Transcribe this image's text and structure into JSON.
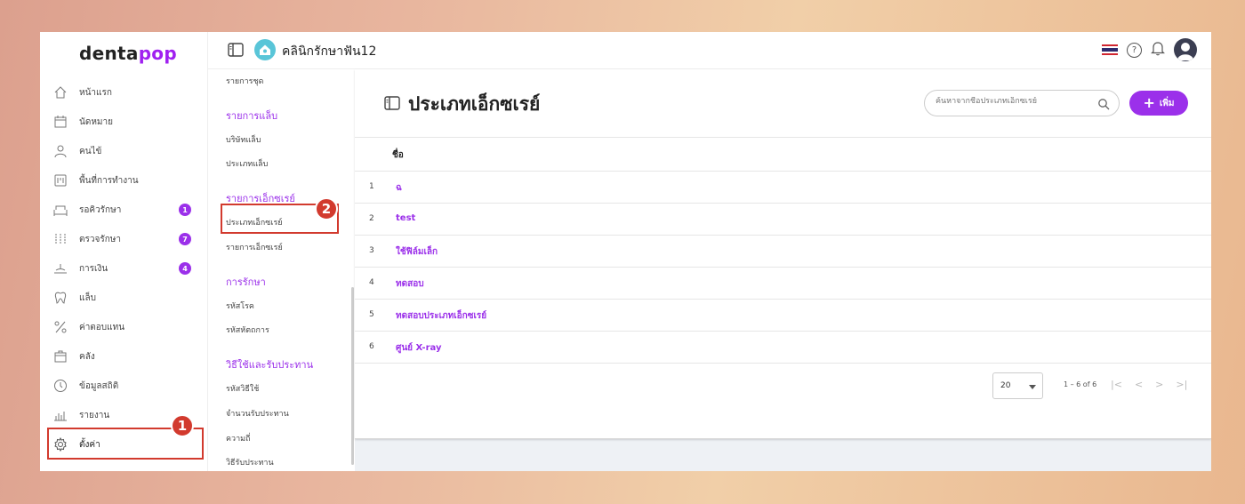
{
  "logo": {
    "part1": "denta",
    "part2": "pop"
  },
  "sidebar": {
    "items": [
      {
        "label": "หน้าแรก",
        "icon": "home-icon"
      },
      {
        "label": "นัดหมาย",
        "icon": "calendar-icon"
      },
      {
        "label": "คนไข้",
        "icon": "user-icon"
      },
      {
        "label": "พื้นที่การทำงาน",
        "icon": "workspace-icon"
      },
      {
        "label": "รอคิวรักษา",
        "icon": "chair-icon",
        "badge": "1"
      },
      {
        "label": "ตรวจรักษา",
        "icon": "tools-icon",
        "badge": "7"
      },
      {
        "label": "การเงิน",
        "icon": "money-icon",
        "badge": "4"
      },
      {
        "label": "แล็บ",
        "icon": "tooth-icon"
      },
      {
        "label": "ค่าตอบแทน",
        "icon": "percent-icon"
      },
      {
        "label": "คลัง",
        "icon": "box-icon"
      },
      {
        "label": "ข้อมูลสถิติ",
        "icon": "stats-icon"
      },
      {
        "label": "รายงาน",
        "icon": "report-icon"
      },
      {
        "label": "ตั้งค่า",
        "icon": "gear-icon"
      }
    ]
  },
  "markers": {
    "one": "1",
    "two": "2"
  },
  "topbar": {
    "clinic_name": "คลินิกรักษาฟัน12"
  },
  "submenu": {
    "top_item": "รายการชุด",
    "groups": [
      {
        "title": "รายการแล็บ",
        "items": [
          "บริษัทแล็บ",
          "ประเภทแล็บ"
        ]
      },
      {
        "title": "รายการเอ็กซเรย์",
        "items": [
          "ประเภทเอ็กซเรย์",
          "รายการเอ็กซเรย์"
        ]
      },
      {
        "title": "การรักษา",
        "items": [
          "รหัสโรค",
          "รหัสหัตถการ"
        ]
      },
      {
        "title": "วิธีใช้และรับประทาน",
        "items": [
          "รหัสวิธีใช้",
          "จำนวนรับประทาน",
          "ความถี่",
          "วิธีรับประทาน"
        ]
      }
    ]
  },
  "main": {
    "title": "ประเภทเอ็กซเรย์",
    "search_placeholder": "ค้นหาจากชื่อประเภทเอ็กซเรย์",
    "add_label": "เพิ่ม",
    "column_name": "ชื่อ",
    "rows": [
      {
        "num": "1",
        "name": "ฉ"
      },
      {
        "num": "2",
        "name": "test"
      },
      {
        "num": "3",
        "name": "ใช้ฟิล์มเล็ก"
      },
      {
        "num": "4",
        "name": "ทดสอบ"
      },
      {
        "num": "5",
        "name": "ทดสอบประเภทเอ็กซเรย์"
      },
      {
        "num": "6",
        "name": "ศูนย์ X-ray"
      }
    ],
    "page_size": "20",
    "range": "1 – 6 of 6"
  }
}
